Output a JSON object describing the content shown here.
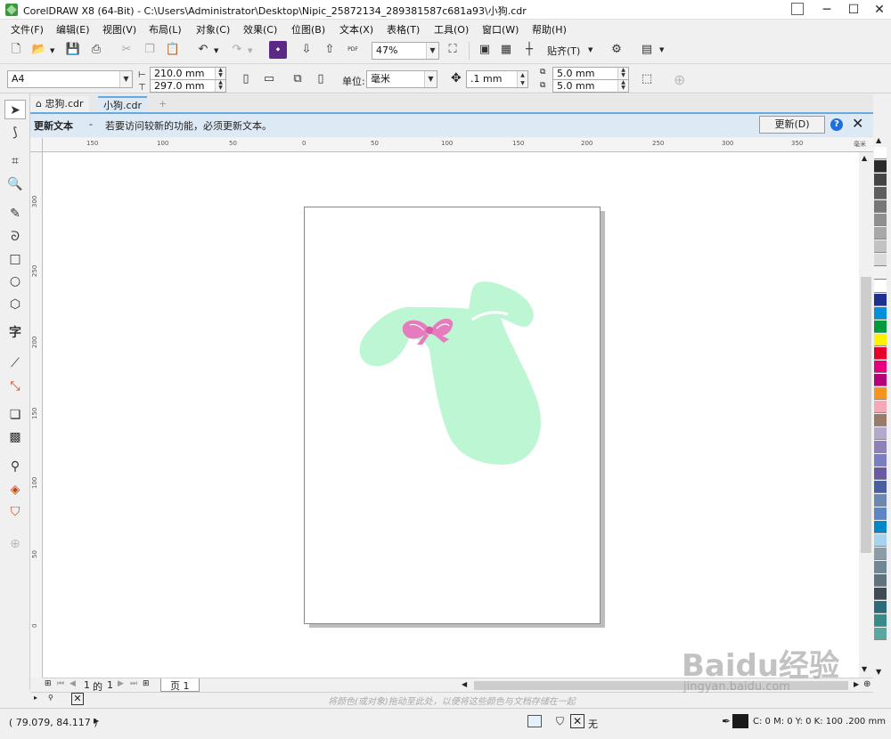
{
  "window": {
    "title": "CorelDRAW X8 (64-Bit) - C:\\Users\\Administrator\\Desktop\\Nipic_25872134_289381587c681a93\\小狗.cdr",
    "minimize": "─",
    "maximize": "☐",
    "close": "✕"
  },
  "menu": [
    "文件(F)",
    "编辑(E)",
    "视图(V)",
    "布局(L)",
    "对象(C)",
    "效果(C)",
    "位图(B)",
    "文本(X)",
    "表格(T)",
    "工具(O)",
    "窗口(W)",
    "帮助(H)"
  ],
  "toolbar": {
    "zoom": "47%",
    "snap": "贴齐(T)",
    "pdf_label": "PDF"
  },
  "property_bar": {
    "page_size": "A4",
    "width": "210.0 mm",
    "height": "297.0 mm",
    "units_label": "单位:",
    "units_value": "毫米",
    "nudge": ".1 mm",
    "dup_x": "5.0 mm",
    "dup_y": "5.0 mm"
  },
  "tabs": [
    {
      "label": "忠狗.cdr",
      "active": false
    },
    {
      "label": "小狗.cdr",
      "active": true
    }
  ],
  "notification": {
    "title": "更新文本",
    "dash": "-",
    "message": "若要访问较新的功能，必须更新文本。",
    "button": "更新(D)",
    "help": "?",
    "close": "✕"
  },
  "ruler": {
    "h_ticks": [
      "150",
      "100",
      "50",
      "0",
      "50",
      "100",
      "150",
      "200",
      "250",
      "300",
      "350"
    ],
    "h_unit": "毫米",
    "v_ticks": [
      "300",
      "250",
      "200",
      "150",
      "100",
      "50",
      "0"
    ]
  },
  "page_nav": {
    "current": "1",
    "of": "的",
    "total": "1",
    "page_tab": "页 1"
  },
  "doc_palette_hint": "将颜色(或对象)拖动至此处，以便将这些颜色与文档存储在一起",
  "status": {
    "coords": "( 79.079, 84.117 )",
    "fill_none": "无",
    "outline": "C: 0 M: 0 Y: 0 K: 100  .200 mm"
  },
  "watermark": {
    "brand": "Baidu经验",
    "url": "jingyan.baidu.com"
  },
  "colors": {
    "dog_body": "#bdf6d3",
    "bow": "#e67bbd",
    "accent_blue": "#1e6fd9",
    "notify_bg": "#dde9f5"
  },
  "palette": [
    "#ffffff",
    "#2b2b2b",
    "#454545",
    "#5e5e5e",
    "#777777",
    "#8f8f8f",
    "#a8a8a8",
    "#c2c2c2",
    "#dadada",
    "#f2f2f2",
    "#ffffff",
    "#1d2f8f",
    "#0090dc",
    "#00993d",
    "#fff200",
    "#e4002b",
    "#e6007e",
    "#b6007a",
    "#f7941d",
    "#f4a9b4",
    "#9a7b6a",
    "#b5a9c9",
    "#8d82b8",
    "#7a7ec1",
    "#6a5aa4",
    "#4a5fa0",
    "#6c87b4",
    "#5f86c2",
    "#0088c8",
    "#a8d3ee",
    "#8a9ca8",
    "#708896",
    "#5d7380",
    "#3f4a54",
    "#2d6b7a",
    "#3a8a8a",
    "#5aa6a0"
  ]
}
